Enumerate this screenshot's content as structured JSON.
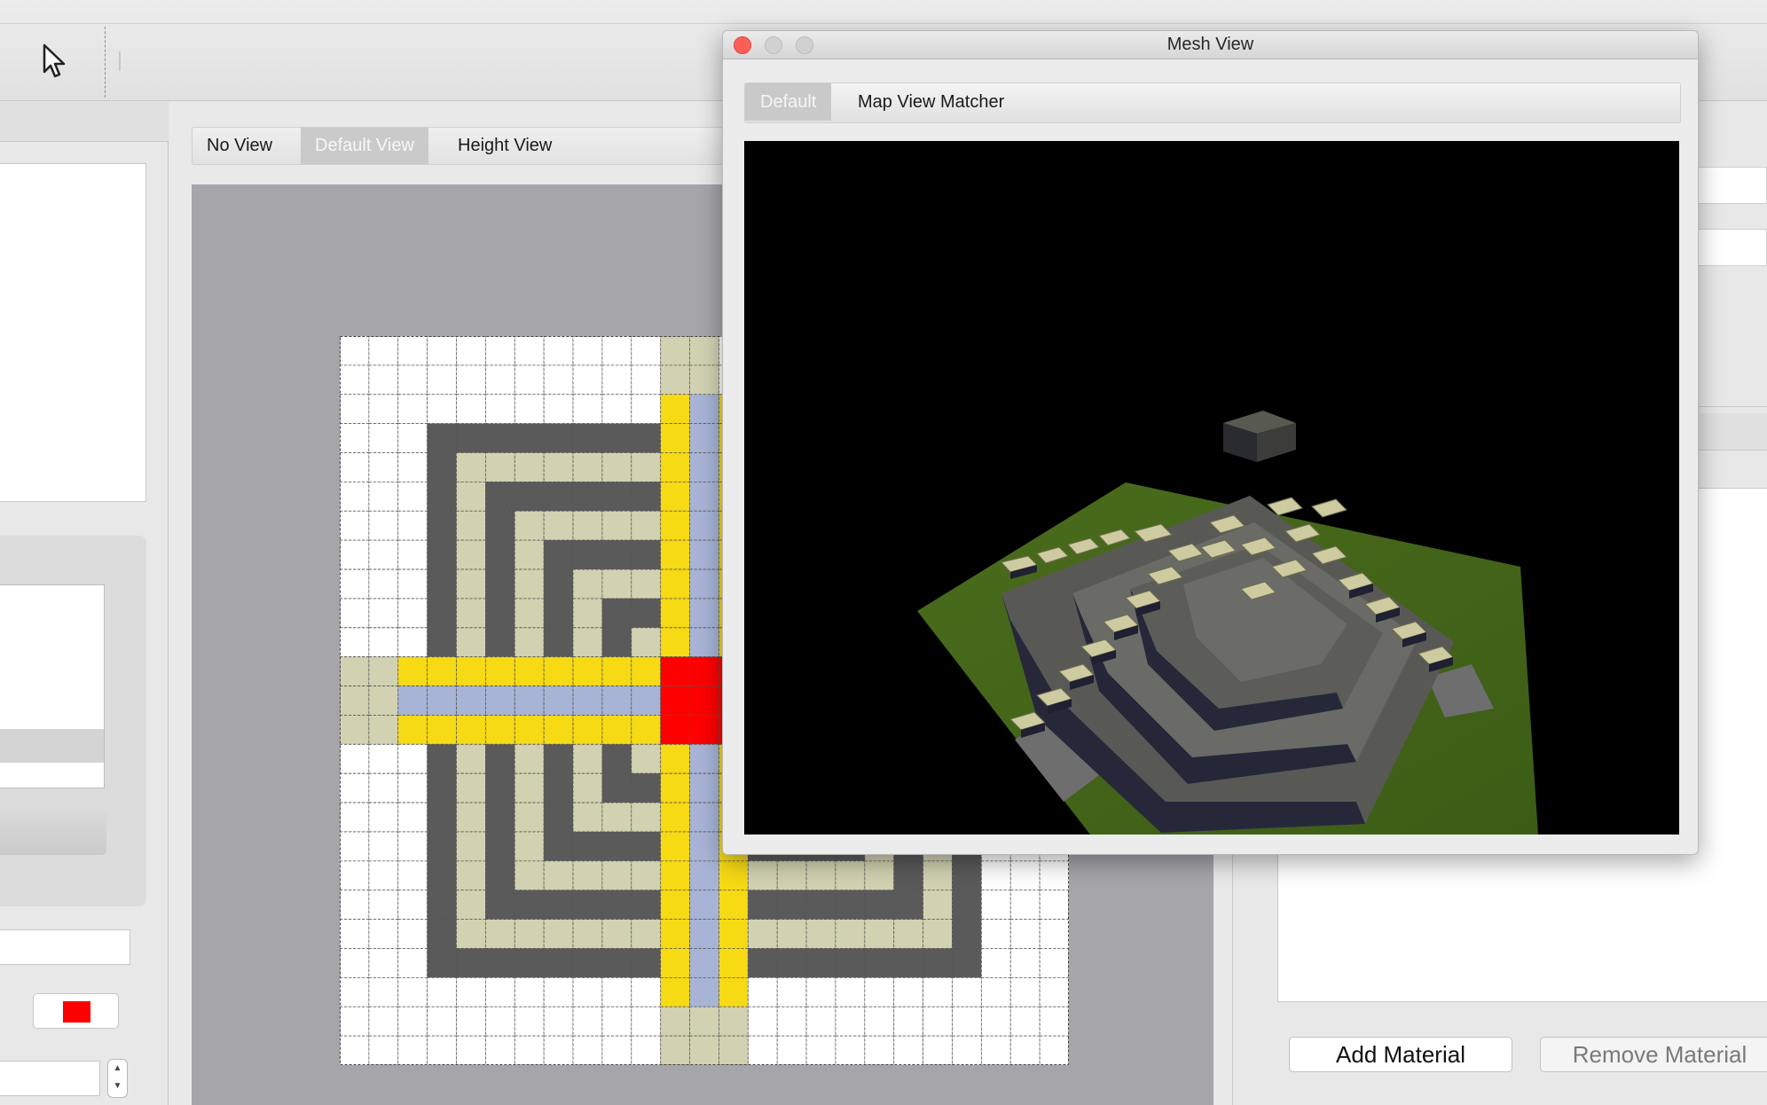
{
  "window": {
    "title": "Mesh View"
  },
  "view_tabs": [
    {
      "label": "No View",
      "selected": false
    },
    {
      "label": "Default View",
      "selected": true
    },
    {
      "label": "Height View",
      "selected": false
    }
  ],
  "mesh_tabs": [
    {
      "label": "Default",
      "selected": true
    },
    {
      "label": "Map View Matcher",
      "selected": false
    }
  ],
  "materials": {
    "add_label": "Add Material",
    "remove_label": "Remove Material"
  },
  "selected_color": "#ff0000",
  "stepper": {
    "up": "▲",
    "down": "▼"
  },
  "tile_colors": {
    "W": "#ffffff",
    "D": "#5a5a5a",
    "B": "#d2d2b2",
    "Y": "#f6da14",
    "L": "#a8b4d6",
    "R": "#ff0000"
  },
  "map_grid": [
    "WWWWWWWWWWWBBWWWWWWWWWWWW",
    "WWWWWWWWWWWBBWWWWWWWWWWWW",
    "WWWWWWWWWWWYLYWWWWWWWWWWW",
    "WWWDDDDDDDDYLYDDDDDDDDWWW",
    "WWWDBBBBBBBYLYBBBBBBBDWWW",
    "WWWDBDDDDDDYLYDDDDDDBDWWW",
    "WWWDBDBBBBBYLYBBBBBDBDWWW",
    "WWWDBDBDDDDYLYDDDDBDBDWWW",
    "WWWDBDBDBBBYLYBBBDBDBDWWW",
    "WWWDBDBDBDDYLYDDBDBDBDWWW",
    "WWWDBDBDBDBYLYBDBDBDBDWWW",
    "BBYYYYYYYYYRRRYYYYYYYYYBB",
    "BBLLLLLLLLLRRRLLLLLLLLLBB",
    "BBYYYYYYYYYRRRYYYYYYYYYBB",
    "WWWDBDBDBDBYLYBDBDBDBDWWW",
    "WWWDBDBDBDDYLYDDBDBDBDWWW",
    "WWWDBDBDBBBYLYBBBDBDBDWWW",
    "WWWDBDBDDDDYLYDDDDBDBDWWW",
    "WWWDBDBBBBBYLYBBBBBDBDWWW",
    "WWWDBDDDDDDYLYDDDDDDBDWWW",
    "WWWDBBBBBBBYLYBBBBBBBDWWW",
    "WWWDDDDDDDDYLYDDDDDDDDWWW",
    "WWWWWWWWWWWYLYWWWWWWWWWWW",
    "WWWWWWWWWWWBBBWWWWWWWWWWW",
    "WWWWWWWWWWWBBBWWWWWWWWWWW"
  ],
  "toolbar_icons": [
    "pointer-arrow-icon"
  ]
}
